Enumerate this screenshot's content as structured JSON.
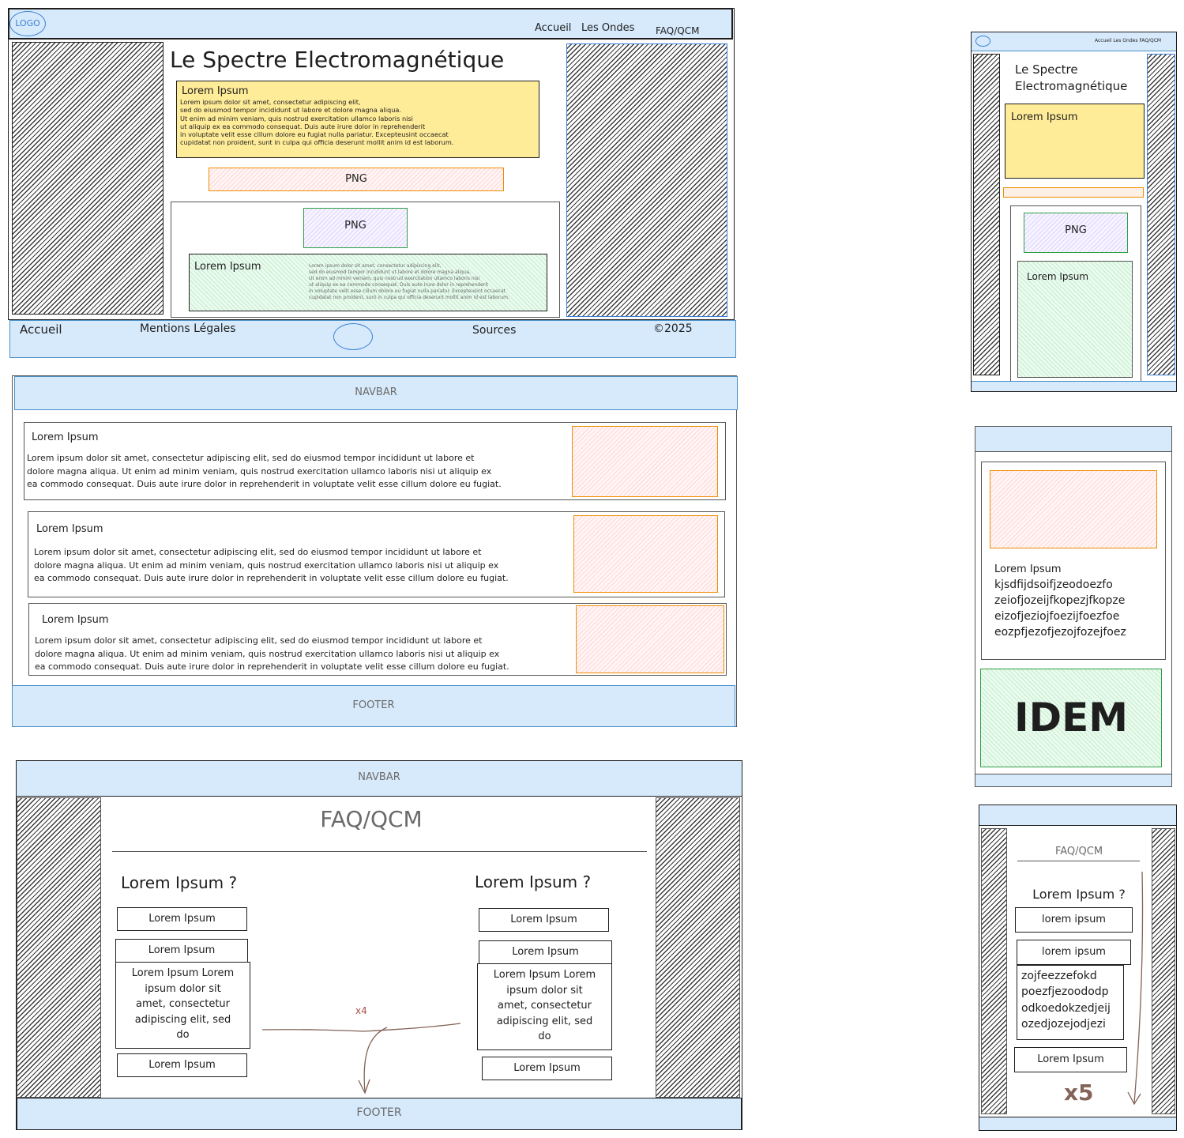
{
  "home_desktop": {
    "logo": "LOGO",
    "nav": [
      "Accueil",
      "Les Ondes",
      "FAQ/QCM"
    ],
    "title": "Le Spectre Electromagnétique",
    "intro_heading": "Lorem Ipsum",
    "intro_text": "Lorem ipsum dolor sit amet, consectetur adipiscing elit,\nsed do eiusmod tempor incididunt ut labore et dolore magna aliqua.\nUt enim ad minim veniam, quis nostrud exercitation ullamco laboris nisi\nut aliquip ex ea commodo consequat. Duis aute irure dolor in reprehenderit\nin voluptate velit esse cillum dolore eu fugiat nulla pariatur. Excepteusint occaecat\ncupidatat non proident, sunt in culpa qui officia deserunt mollit anim id est laborum.",
    "banner_label": "PNG",
    "card_image_label": "PNG",
    "card_heading": "Lorem Ipsum",
    "card_text": "Lorem ipsum dolor sit amet, consectetur adipiscing elit,\nsed do eiusmod tempor incididunt ut labore et dolore magna aliqua.\nUt enim ad minim veniam, quis nostrud exercitation ullamco laboris nisi\nut aliquip ex ea commodo consequat. Duis aute irure dolor in reprehenderit\nin voluptate velit esse cillum dolore eu fugiat nulla pariatur. Excepteusint occaecat\ncupidatat non proident, sunt in culpa qui officia deserunt mollit anim id est laborum.",
    "footer": [
      "Accueil",
      "Mentions Légales",
      "Sources",
      "©2025"
    ]
  },
  "home_mobile": {
    "nav": "Accueil Les Ondes FAQ/QCM",
    "title_line1": "Le Spectre",
    "title_line2": "Electromagnétique",
    "intro_heading": "Lorem Ipsum",
    "card_image_label": "PNG",
    "card_heading": "Lorem Ipsum"
  },
  "ondes_desktop": {
    "navbar": "NAVBAR",
    "footer": "FOOTER",
    "items": [
      {
        "heading": "Lorem Ipsum",
        "text": "Lorem ipsum dolor sit amet, consectetur adipiscing elit, sed do eiusmod tempor incididunt ut labore et\ndolore magna aliqua. Ut enim ad minim veniam, quis nostrud exercitation ullamco laboris nisi ut aliquip ex\nea commodo consequat. Duis aute irure dolor in reprehenderit in voluptate velit esse cillum dolore eu fugiat."
      },
      {
        "heading": "Lorem Ipsum",
        "text": "Lorem ipsum dolor sit amet, consectetur adipiscing elit, sed do eiusmod tempor incididunt ut labore et\ndolore magna aliqua. Ut enim ad minim veniam, quis nostrud exercitation ullamco laboris nisi ut aliquip ex\nea commodo consequat. Duis aute irure dolor in reprehenderit in voluptate velit esse cillum dolore eu fugiat."
      },
      {
        "heading": "Lorem Ipsum",
        "text": "Lorem ipsum dolor sit amet, consectetur adipiscing elit, sed do eiusmod tempor incididunt ut labore et\ndolore magna aliqua. Ut enim ad minim veniam, quis nostrud exercitation ullamco laboris nisi ut aliquip ex\nea commodo consequat. Duis aute irure dolor in reprehenderit in voluptate velit esse cillum dolore eu fugiat."
      }
    ]
  },
  "ondes_mobile": {
    "heading": "Lorem Ipsum",
    "text": "kjsdfijdsoifjzeodoezfo\nzeiofjozeijfkopezjfkopze\neizofjeziojfoezijfoezfoe\neozpfjezofjezojfozejfoez",
    "idem": "IDEM"
  },
  "faq_desktop": {
    "navbar": "NAVBAR",
    "title": "FAQ/QCM",
    "footer": "FOOTER",
    "repeat_note": "x4",
    "columns": [
      {
        "question": "Lorem Ipsum ?",
        "option1": "Lorem Ipsum",
        "option2": "Lorem Ipsum",
        "answer": "Lorem Ipsum Lorem\nipsum dolor sit\namet, consectetur\nadipiscing elit, sed\ndo",
        "option3": "Lorem Ipsum"
      },
      {
        "question": "Lorem Ipsum ?",
        "option1": "Lorem Ipsum",
        "option2": "Lorem Ipsum",
        "answer": "Lorem Ipsum Lorem\nipsum dolor sit\namet, consectetur\nadipiscing elit, sed\ndo",
        "option3": "Lorem Ipsum"
      }
    ]
  },
  "faq_mobile": {
    "title": "FAQ/QCM",
    "question": "Lorem Ipsum ?",
    "option1": "lorem ipsum",
    "option2": "lorem ipsum",
    "answer": "zojfeezzefokd\npoezfjezoododp\nodkoedokzedjeij\nozedjozejodjezi",
    "option3": "Lorem Ipsum",
    "repeat_note": "x5"
  },
  "colors": {
    "navbar_fill": "#d7eafc",
    "yellow_box": "#ffec99",
    "image_stroke": "#f08c00",
    "card_fill": "#ebfbee",
    "arrow": "#846358"
  }
}
